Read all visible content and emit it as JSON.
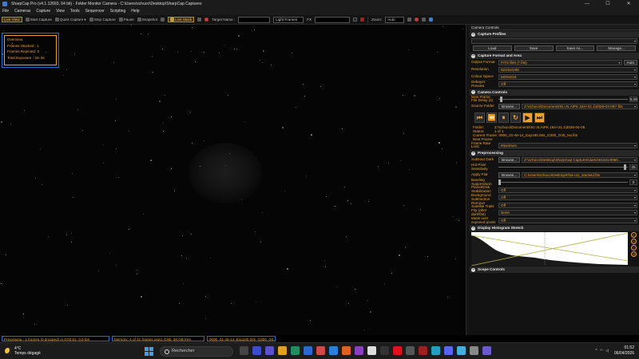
{
  "window": {
    "title": "SharpCap Pro (v4.1.12693, 64 bit) - Folder Monitor Camera - C:\\Users\\schuco\\Desktop\\SharpCap Captures",
    "controls": [
      "—",
      "☐",
      "✕"
    ]
  },
  "menu": [
    "File",
    "Cameras",
    "Capture",
    "View",
    "Tools",
    "Sequencer",
    "Scripting",
    "Help"
  ],
  "toolbar": {
    "live_view": "Live View",
    "start_capture": "Start Capture",
    "quick_capture": "Quick Capture",
    "stop_capture": "Stop Capture",
    "pause": "Pause",
    "snapshot": "Snapshot",
    "live_stack": "Live Stack",
    "target_name_label": "Target Name :",
    "target_name_value": "",
    "frame_type": "Light Frames",
    "fx_label": "FX",
    "fx_value": "",
    "zoom_label": "Zoom:",
    "zoom_value": "Auto"
  },
  "overview": {
    "title": "Overview",
    "frames_stacked": "Frames Stacked : 1",
    "frames_rejected": "Frames Rejected: 0",
    "total_exposure": "Total Exposure : 3m 0s"
  },
  "panel": {
    "title": "Camera Controls",
    "capture_profiles": {
      "header": "Capture Profiles",
      "buttons": [
        "Load",
        "Save",
        "Save As...",
        "Manage..."
      ]
    },
    "capture_format": {
      "header": "Capture Format and Area",
      "output_format_label": "Output Format",
      "output_format_value": "FITS files (*.fits)",
      "auto_label": "Auto",
      "resolution_label": "Resolution",
      "resolution_value": "6224x4168",
      "colour_space_label": "Colour Space",
      "colour_space_value": "MONO16",
      "debayer_label": "Debayer Preview",
      "debayer_value": "Off"
    },
    "camera_controls": {
      "header": "Camera Controls",
      "new_frame_label": "New Frame File Delay (s)",
      "new_frame_value": "5.00",
      "source_folder_label": "Source Folder",
      "browse_label": "Browse...",
      "source_folder_value": "Z:\\schuco\\Documents\\N.I.N.AIPK 164+31.1\\2026-04-05\\*.fits",
      "player_buttons": [
        "⏮",
        "⏪",
        "⏸",
        "↻",
        "▶",
        "⏭"
      ],
      "folder_label": "Folder:",
      "folder_value": "Z:\\schuco\\Documents\\N.I.N.AIPK 164+31.1\\2026-04-05",
      "status_label": "Status:",
      "status_value": "1 of 1",
      "current_frame_label": "Current Frame:",
      "current_frame_value": "0000_01-46-14_Exp180.00s_G300_O30_Ha.fits",
      "next_frame_label": "Next Frame:",
      "next_frame_value": "",
      "frame_rate_label": "Frame Rate Limit",
      "frame_rate_value": "Maximum"
    },
    "preprocessing": {
      "header": "Preprocessing",
      "subtract_dark_label": "Subtract Dark",
      "subtract_dark_value": "Z:\\schuco\\Desktop\\SharpCap Captures\\darks\\6192x4096\\...",
      "hot_pixel_label": "Hot Pixel Sensitivity",
      "hot_pixel_value": "25",
      "apply_flat_label": "Apply Flat",
      "apply_flat_value": "C:\\Users\\schuco\\Desktop\\Flat-c11_stacked.fits",
      "banding_label": "Banding Suppression",
      "banding_value": "0",
      "planet_disk_label": "Planet/Disk Stabilization",
      "planet_disk_value": "Off",
      "background_label": "Background Subtraction",
      "background_value": "Off",
      "satellite_label": "Remove Satellite Trails",
      "satellite_value": "Off",
      "flip_label": "Flip (after dark/flat)",
      "flip_value": "None",
      "mask_label": "Mask over exposed pixels",
      "mask_value": "Off"
    },
    "histogram": {
      "header": "Display Histogram Stretch"
    },
    "scope_controls": {
      "header": "Scope Controls"
    }
  },
  "status": {
    "previewing": "Previewing : 1 frames (0 dropped) in 0:02:51, 0.0 fps",
    "memory": "Memory: 4 of 41 frames used. Disk: 38 GB free",
    "file": "0000_01-46-14_Exp180.00s_G300_O3..."
  },
  "taskbar": {
    "weather_temp": "4°C",
    "weather_desc": "Temps dégagé",
    "search": "Rechercher",
    "time": "01:52",
    "date": "06/04/2026"
  }
}
